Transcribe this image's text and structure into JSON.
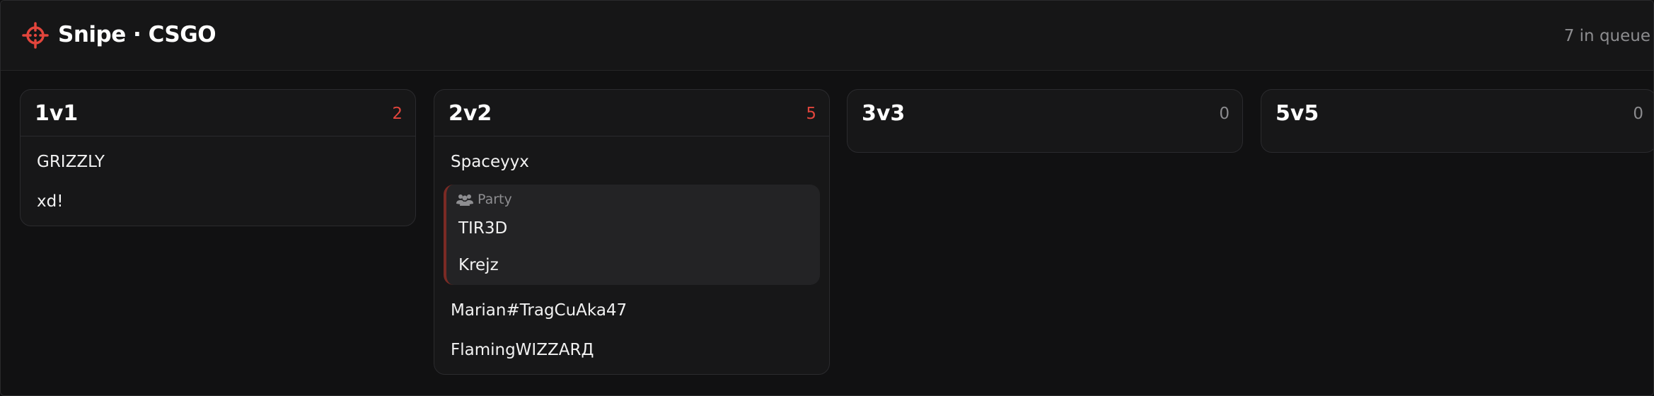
{
  "app": {
    "title": "Snipe · CSGO",
    "queue_status": "7 in queue",
    "accent_color": "#e2453c",
    "logo_icon": "crosshair-icon"
  },
  "modes": [
    {
      "name": "1v1",
      "count": "2",
      "players": [
        "GRIZZLY",
        "xd!"
      ]
    },
    {
      "name": "2v2",
      "count": "5",
      "players_before": [
        "Spaceyyx"
      ],
      "party": {
        "label": "Party",
        "icon": "users-icon",
        "members": [
          "TIR3D",
          "Krejz"
        ]
      },
      "players_after": [
        "Marian#TragCuAka47",
        "FlamingWIZZARД"
      ]
    },
    {
      "name": "3v3",
      "count": "0",
      "players": []
    },
    {
      "name": "5v5",
      "count": "0",
      "players": []
    }
  ]
}
